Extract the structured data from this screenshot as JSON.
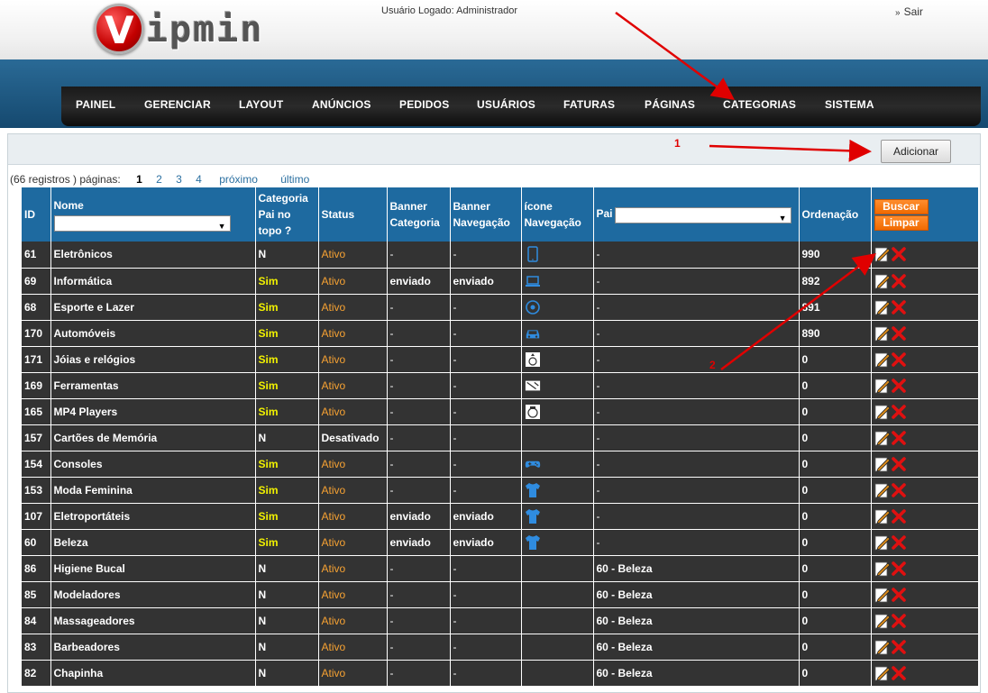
{
  "header": {
    "logo_text": "ipmin",
    "logo_letter": "V",
    "logged_user": "Usuário Logado: Administrador",
    "logout": "Sair",
    "logout_prefix": "»"
  },
  "nav": [
    "PAINEL",
    "GERENCIAR",
    "LAYOUT",
    "ANÚNCIOS",
    "PEDIDOS",
    "USUÁRIOS",
    "FATURAS",
    "PÁGINAS",
    "CATEGORIAS",
    "SISTEMA"
  ],
  "toolbar": {
    "add_label": "Adicionar"
  },
  "pager": {
    "summary": "(66 registros ) páginas:",
    "current": "1",
    "pages": [
      "2",
      "3",
      "4"
    ],
    "next": "próximo",
    "last": "último"
  },
  "table": {
    "headers": {
      "id": "ID",
      "name": "Nome",
      "top": "Categoria Pai no topo ?",
      "status": "Status",
      "banner_cat": "Banner Categoria",
      "banner_nav": "Banner Navegação",
      "icon_nav": "ícone Navegação",
      "parent": "Pai",
      "order": "Ordenação",
      "search": "Buscar",
      "clear": "Limpar"
    },
    "rows": [
      {
        "id": "61",
        "name": "Eletrônicos",
        "top": "N",
        "status": "Ativo",
        "bcat": "-",
        "bnav": "-",
        "icon": "tablet-icon",
        "parent": "-",
        "order": "990"
      },
      {
        "id": "69",
        "name": "Informática",
        "top": "Sim",
        "status": "Ativo",
        "bcat": "enviado",
        "bnav": "enviado",
        "icon": "laptop-icon",
        "parent": "-",
        "order": "892"
      },
      {
        "id": "68",
        "name": "Esporte e Lazer",
        "top": "Sim",
        "status": "Ativo",
        "bcat": "-",
        "bnav": "-",
        "icon": "ball-icon",
        "parent": "-",
        "order": "891"
      },
      {
        "id": "170",
        "name": "Automóveis",
        "top": "Sim",
        "status": "Ativo",
        "bcat": "-",
        "bnav": "-",
        "icon": "car-icon",
        "parent": "-",
        "order": "890"
      },
      {
        "id": "171",
        "name": "Jóias e relógios",
        "top": "Sim",
        "status": "Ativo",
        "bcat": "-",
        "bnav": "-",
        "icon": "ring-icon",
        "parent": "-",
        "order": "0"
      },
      {
        "id": "169",
        "name": "Ferramentas",
        "top": "Sim",
        "status": "Ativo",
        "bcat": "-",
        "bnav": "-",
        "icon": "tools-icon",
        "parent": "-",
        "order": "0"
      },
      {
        "id": "165",
        "name": "MP4 Players",
        "top": "Sim",
        "status": "Ativo",
        "bcat": "-",
        "bnav": "-",
        "icon": "player-icon",
        "parent": "-",
        "order": "0"
      },
      {
        "id": "157",
        "name": "Cartões de Memória",
        "top": "N",
        "status": "Desativado",
        "bcat": "-",
        "bnav": "-",
        "icon": "",
        "parent": "-",
        "order": "0"
      },
      {
        "id": "154",
        "name": "Consoles",
        "top": "Sim",
        "status": "Ativo",
        "bcat": "-",
        "bnav": "-",
        "icon": "gamepad-icon",
        "parent": "-",
        "order": "0"
      },
      {
        "id": "153",
        "name": "Moda Feminina",
        "top": "Sim",
        "status": "Ativo",
        "bcat": "-",
        "bnav": "-",
        "icon": "shirt-icon",
        "parent": "-",
        "order": "0"
      },
      {
        "id": "107",
        "name": "Eletroportáteis",
        "top": "Sim",
        "status": "Ativo",
        "bcat": "enviado",
        "bnav": "enviado",
        "icon": "shirt-icon",
        "parent": "-",
        "order": "0"
      },
      {
        "id": "60",
        "name": "Beleza",
        "top": "Sim",
        "status": "Ativo",
        "bcat": "enviado",
        "bnav": "enviado",
        "icon": "shirt-icon",
        "parent": "-",
        "order": "0"
      },
      {
        "id": "86",
        "name": "Higiene Bucal",
        "top": "N",
        "status": "Ativo",
        "bcat": "-",
        "bnav": "-",
        "icon": "",
        "parent": "60 - Beleza",
        "order": "0"
      },
      {
        "id": "85",
        "name": "Modeladores",
        "top": "N",
        "status": "Ativo",
        "bcat": "-",
        "bnav": "-",
        "icon": "",
        "parent": "60 - Beleza",
        "order": "0"
      },
      {
        "id": "84",
        "name": "Massageadores",
        "top": "N",
        "status": "Ativo",
        "bcat": "-",
        "bnav": "-",
        "icon": "",
        "parent": "60 - Beleza",
        "order": "0"
      },
      {
        "id": "83",
        "name": "Barbeadores",
        "top": "N",
        "status": "Ativo",
        "bcat": "-",
        "bnav": "-",
        "icon": "",
        "parent": "60 - Beleza",
        "order": "0"
      },
      {
        "id": "82",
        "name": "Chapinha",
        "top": "N",
        "status": "Ativo",
        "bcat": "-",
        "bnav": "-",
        "icon": "",
        "parent": "60 - Beleza",
        "order": "0"
      }
    ]
  },
  "annotations": {
    "one": "1",
    "two": "2"
  },
  "colors": {
    "nav_bg": "#1e6aa0",
    "row_bg": "#333333",
    "sim": "#f2f200",
    "ativo": "#f7a233",
    "button": "#f07a10",
    "arrow": "#e00000"
  }
}
